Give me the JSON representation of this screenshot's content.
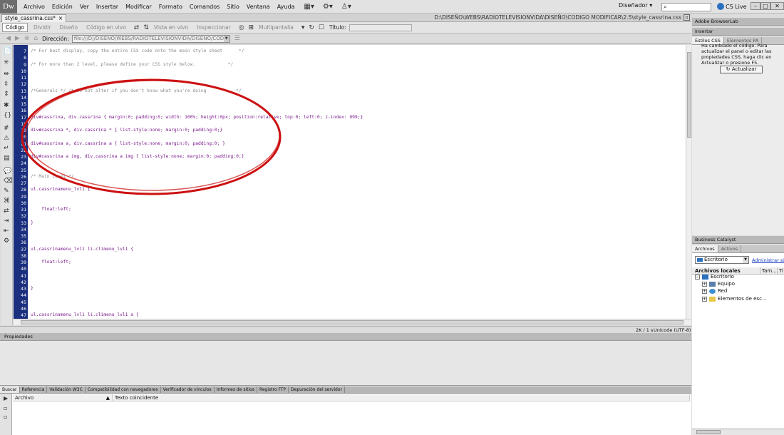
{
  "app": {
    "logo": "Dw"
  },
  "menubar": {
    "items": [
      "Archivo",
      "Edición",
      "Ver",
      "Insertar",
      "Modificar",
      "Formato",
      "Comandos",
      "Sitio",
      "Ventana",
      "Ayuda"
    ],
    "workspace": "Diseñador",
    "search_value": "",
    "cs_live": "CS Live"
  },
  "document": {
    "tab_label": "style_cassrina.css*",
    "tab_close": "×",
    "path": "D:\\DISEÑO\\WEBS\\RADIOTELEVISIONVIDA\\DISEÑO\\CODIGO MODIFICAR\\2.5\\style_cassrina.css"
  },
  "toolbar": {
    "code": "Código",
    "split": "Dividir",
    "design": "Diseño",
    "live_code": "Código en vivo",
    "live_view": "Vista en vivo",
    "inspect": "Inspeccionar",
    "multiscreen": "Multipantalla",
    "title_label": "Título:",
    "title_value": ""
  },
  "address": {
    "label": "Dirección:",
    "value": "file:///D|/DISEÑO/WEBS/RADIOTELEVISIONVIDA/DISEÑO/CODIGO MODIFICAR"
  },
  "code_lines": [
    {
      "n": "7",
      "text": "/* For best display, copy the entire CSS code onto the main style sheet      */",
      "kind": "comment"
    },
    {
      "n": "8",
      "text": "",
      "kind": "code"
    },
    {
      "n": "9",
      "text": "/* For more than 2 level, please define your CSS style below.            */",
      "kind": "comment"
    },
    {
      "n": "10",
      "text": "",
      "kind": "code"
    },
    {
      "n": "11",
      "text": "",
      "kind": "code"
    },
    {
      "n": "12",
      "text": "",
      "kind": "code"
    },
    {
      "n": "13",
      "text": "/*Generals */ /* Do not alter if you don't know what you're doing           */",
      "kind": "comment"
    },
    {
      "n": "14",
      "text": "",
      "kind": "code"
    },
    {
      "n": "15",
      "text": "",
      "kind": "code"
    },
    {
      "n": "16",
      "text": "",
      "kind": "code"
    },
    {
      "n": "17",
      "text": "div#cassrina, div.cassrina { margin:0; padding:0; width: 100%; height:0px; position:relative; top:0; left:0; z-index: 999;}",
      "kind": "code"
    },
    {
      "n": "18",
      "text": "",
      "kind": "code"
    },
    {
      "n": "19",
      "text": "div#cassrina *, div.cassrina * { list-style:none; margin:0; padding:0;}",
      "kind": "code"
    },
    {
      "n": "20",
      "text": "",
      "kind": "code"
    },
    {
      "n": "21",
      "text": "div#cassrina a, div.cassrina a { list-style:none; margin:0; padding:0; }",
      "kind": "code"
    },
    {
      "n": "22",
      "text": "",
      "kind": "code"
    },
    {
      "n": "23",
      "text": "div#cassrina a img, div.cassrina a img { list-style:none; margin:0; padding:0;}",
      "kind": "code"
    },
    {
      "n": "24",
      "text": "",
      "kind": "code"
    },
    {
      "n": "25",
      "text": "",
      "kind": "code"
    },
    {
      "n": "26",
      "text": "/* Main Level */",
      "kind": "comment"
    },
    {
      "n": "27",
      "text": "",
      "kind": "code"
    },
    {
      "n": "28",
      "text": "ul.cassrinamenu_lvl1 {",
      "kind": "code"
    },
    {
      "n": "29",
      "text": "",
      "kind": "code"
    },
    {
      "n": "30",
      "text": "",
      "kind": "code"
    },
    {
      "n": "31",
      "text": "    float:left;",
      "kind": "code"
    },
    {
      "n": "32",
      "text": "",
      "kind": "code"
    },
    {
      "n": "33",
      "text": "}",
      "kind": "code"
    },
    {
      "n": "34",
      "text": "",
      "kind": "code"
    },
    {
      "n": "35",
      "text": "",
      "kind": "code"
    },
    {
      "n": "36",
      "text": "",
      "kind": "code"
    },
    {
      "n": "37",
      "text": "ul.cassrinamenu_lvl1 li.climenu_lvl1 {",
      "kind": "code"
    },
    {
      "n": "38",
      "text": "",
      "kind": "code"
    },
    {
      "n": "39",
      "text": "    float:left;",
      "kind": "code"
    },
    {
      "n": "40",
      "text": "",
      "kind": "code"
    },
    {
      "n": "41",
      "text": "",
      "kind": "code"
    },
    {
      "n": "42",
      "text": "",
      "kind": "code"
    },
    {
      "n": "43",
      "text": "}",
      "kind": "code"
    },
    {
      "n": "44",
      "text": "",
      "kind": "code"
    },
    {
      "n": "45",
      "text": "",
      "kind": "code"
    },
    {
      "n": "46",
      "text": "",
      "kind": "code"
    },
    {
      "n": "47",
      "text": "ul.cassrinamenu_lvl1 li.climenu_lvl1 a {",
      "kind": "code"
    }
  ],
  "status": {
    "size": "2K / 1 s",
    "encoding": "Unicode (UTF-8)"
  },
  "properties": {
    "title": "Propiedades"
  },
  "results": {
    "tabs": [
      "Buscar",
      "Referencia",
      "Validación W3C",
      "Compatibilidad con navegadores",
      "Verificador de vínculos",
      "Informes de sitios",
      "Registro FTP",
      "Depuración del servidor"
    ],
    "col_file": "Archivo",
    "col_match": "Texto coincidente"
  },
  "right_panels": {
    "browserlab": "Adobe BrowserLab",
    "insert": "Insertar",
    "css_tabs": [
      "Estilos CSS",
      "Elementos PA"
    ],
    "css_message": "Ha cambiado el código. Para actualizar el panel o editar las propiedades CSS, haga clic en Actualizar o presione F5.",
    "refresh_button": "Actualizar",
    "business_catalyst": "Business Catalyst",
    "files_tabs": [
      "Archivos",
      "Activos"
    ],
    "site_select": "Escritorio",
    "manage_sites": "Administrar sitios",
    "tree_header": {
      "local": "Archivos locales",
      "size": "Tam...",
      "type": "Ti"
    },
    "tree_items": [
      "Escritorio",
      "Equipo",
      "Red",
      "Elementos de esc..."
    ]
  },
  "colors": {
    "gutter": "#1a2f7e",
    "comment": "#8b8b8b",
    "code": "#7c1b8c",
    "annotation": "#cc1111"
  }
}
